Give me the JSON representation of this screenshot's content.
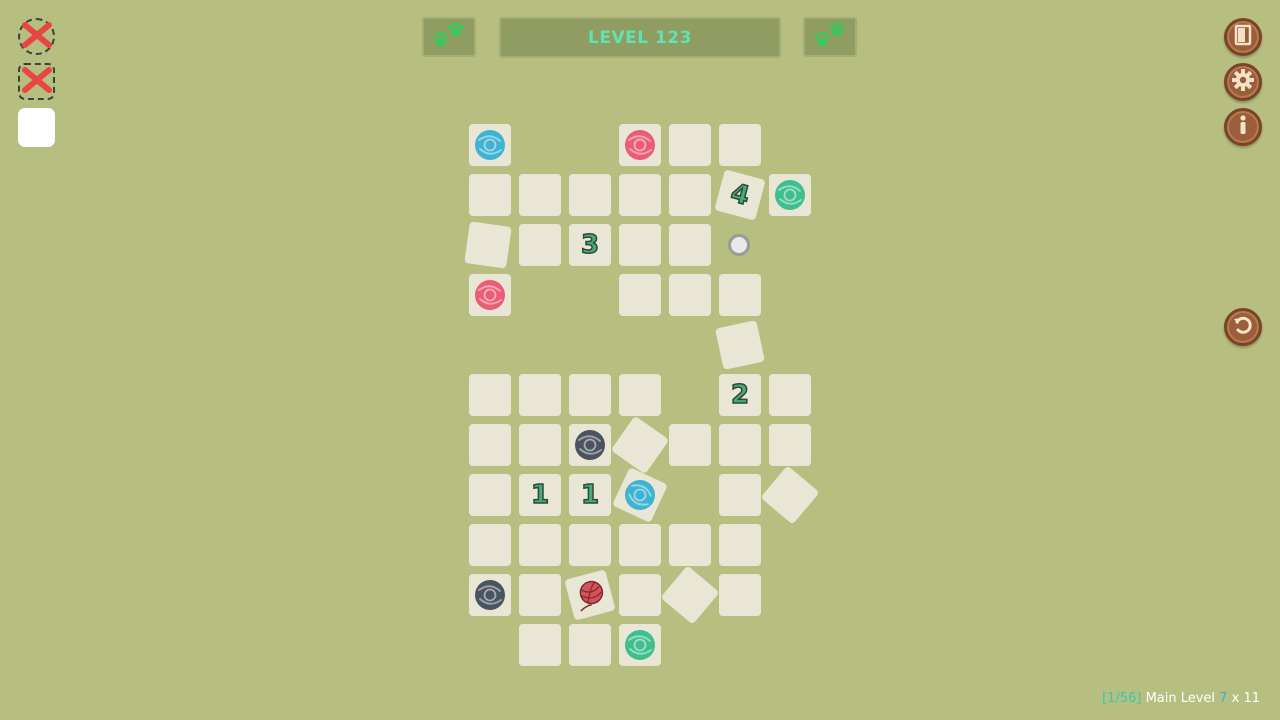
{
  "header": {
    "level_label": "LEVEL 123",
    "left_button_icon": "paw-prints-icon",
    "right_button_icon": "paw-prints-icon"
  },
  "status": [
    {
      "state": "failed",
      "icon": "red-x-icon"
    },
    {
      "state": "failed",
      "icon": "red-x-icon"
    },
    {
      "state": "empty",
      "icon": "none"
    }
  ],
  "side_buttons": [
    {
      "name": "exit",
      "icon": "door-icon"
    },
    {
      "name": "settings",
      "icon": "gear-icon"
    },
    {
      "name": "info",
      "icon": "info-icon"
    },
    {
      "name": "undo",
      "icon": "undo-icon"
    }
  ],
  "board": {
    "tiles": [
      {
        "id": "r0c0",
        "content": "swirl",
        "color": "#3fb3d1"
      },
      {
        "id": "r0c3",
        "content": "swirl",
        "color": "#ea5d75"
      },
      {
        "id": "r0c4",
        "content": "empty"
      },
      {
        "id": "r0c5",
        "content": "empty"
      },
      {
        "id": "r1c0",
        "content": "empty"
      },
      {
        "id": "r1c1",
        "content": "empty"
      },
      {
        "id": "r1c2",
        "content": "empty"
      },
      {
        "id": "r1c3",
        "content": "empty"
      },
      {
        "id": "r1c4",
        "content": "empty"
      },
      {
        "id": "r1c5",
        "content": "number",
        "value": "4"
      },
      {
        "id": "r1c6",
        "content": "swirl",
        "color": "#3fbf8f"
      },
      {
        "id": "r2c0",
        "content": "empty"
      },
      {
        "id": "r2c1",
        "content": "empty"
      },
      {
        "id": "r2c2",
        "content": "number",
        "value": "3"
      },
      {
        "id": "r2c3",
        "content": "empty"
      },
      {
        "id": "r2c4",
        "content": "empty"
      },
      {
        "id": "r3c0",
        "content": "swirl",
        "color": "#ea5d75"
      },
      {
        "id": "r3c3",
        "content": "empty"
      },
      {
        "id": "r3c4",
        "content": "empty"
      },
      {
        "id": "r3c5",
        "content": "empty"
      },
      {
        "id": "r4c5",
        "content": "empty"
      },
      {
        "id": "r5c0",
        "content": "empty"
      },
      {
        "id": "r5c1",
        "content": "empty"
      },
      {
        "id": "r5c2",
        "content": "empty"
      },
      {
        "id": "r5c3",
        "content": "empty"
      },
      {
        "id": "r5c5",
        "content": "number",
        "value": "2"
      },
      {
        "id": "r5c6",
        "content": "empty"
      },
      {
        "id": "r6c0",
        "content": "empty"
      },
      {
        "id": "r6c1",
        "content": "empty"
      },
      {
        "id": "r6c2",
        "content": "swirl",
        "color": "#4a5360"
      },
      {
        "id": "r6c3",
        "content": "empty"
      },
      {
        "id": "r6c4",
        "content": "empty"
      },
      {
        "id": "r6c5",
        "content": "empty"
      },
      {
        "id": "r6c6",
        "content": "empty"
      },
      {
        "id": "r7c0",
        "content": "empty"
      },
      {
        "id": "r7c1",
        "content": "number",
        "value": "1"
      },
      {
        "id": "r7c2",
        "content": "number",
        "value": "1"
      },
      {
        "id": "r7c3",
        "content": "swirl",
        "color": "#3fb3d1"
      },
      {
        "id": "r7c5",
        "content": "empty"
      },
      {
        "id": "r7c6",
        "content": "empty"
      },
      {
        "id": "r8c0",
        "content": "empty"
      },
      {
        "id": "r8c1",
        "content": "empty"
      },
      {
        "id": "r8c2",
        "content": "empty"
      },
      {
        "id": "r8c3",
        "content": "empty"
      },
      {
        "id": "r8c4",
        "content": "empty"
      },
      {
        "id": "r8c5",
        "content": "empty"
      },
      {
        "id": "r9c0",
        "content": "swirl",
        "color": "#4a5360"
      },
      {
        "id": "r9c1",
        "content": "empty"
      },
      {
        "id": "r9c2",
        "content": "yarn",
        "color": "#d4525a"
      },
      {
        "id": "r9c3",
        "content": "empty"
      },
      {
        "id": "r9c4",
        "content": "empty"
      },
      {
        "id": "r9c5",
        "content": "empty"
      },
      {
        "id": "r10c1",
        "content": "empty"
      },
      {
        "id": "r10c2",
        "content": "empty"
      },
      {
        "id": "r10c3",
        "content": "swirl",
        "color": "#3fbf8f"
      }
    ]
  },
  "footer": {
    "progress": "[1/56]",
    "label": "Main Level",
    "width": "7",
    "x": "x",
    "height": "11"
  }
}
